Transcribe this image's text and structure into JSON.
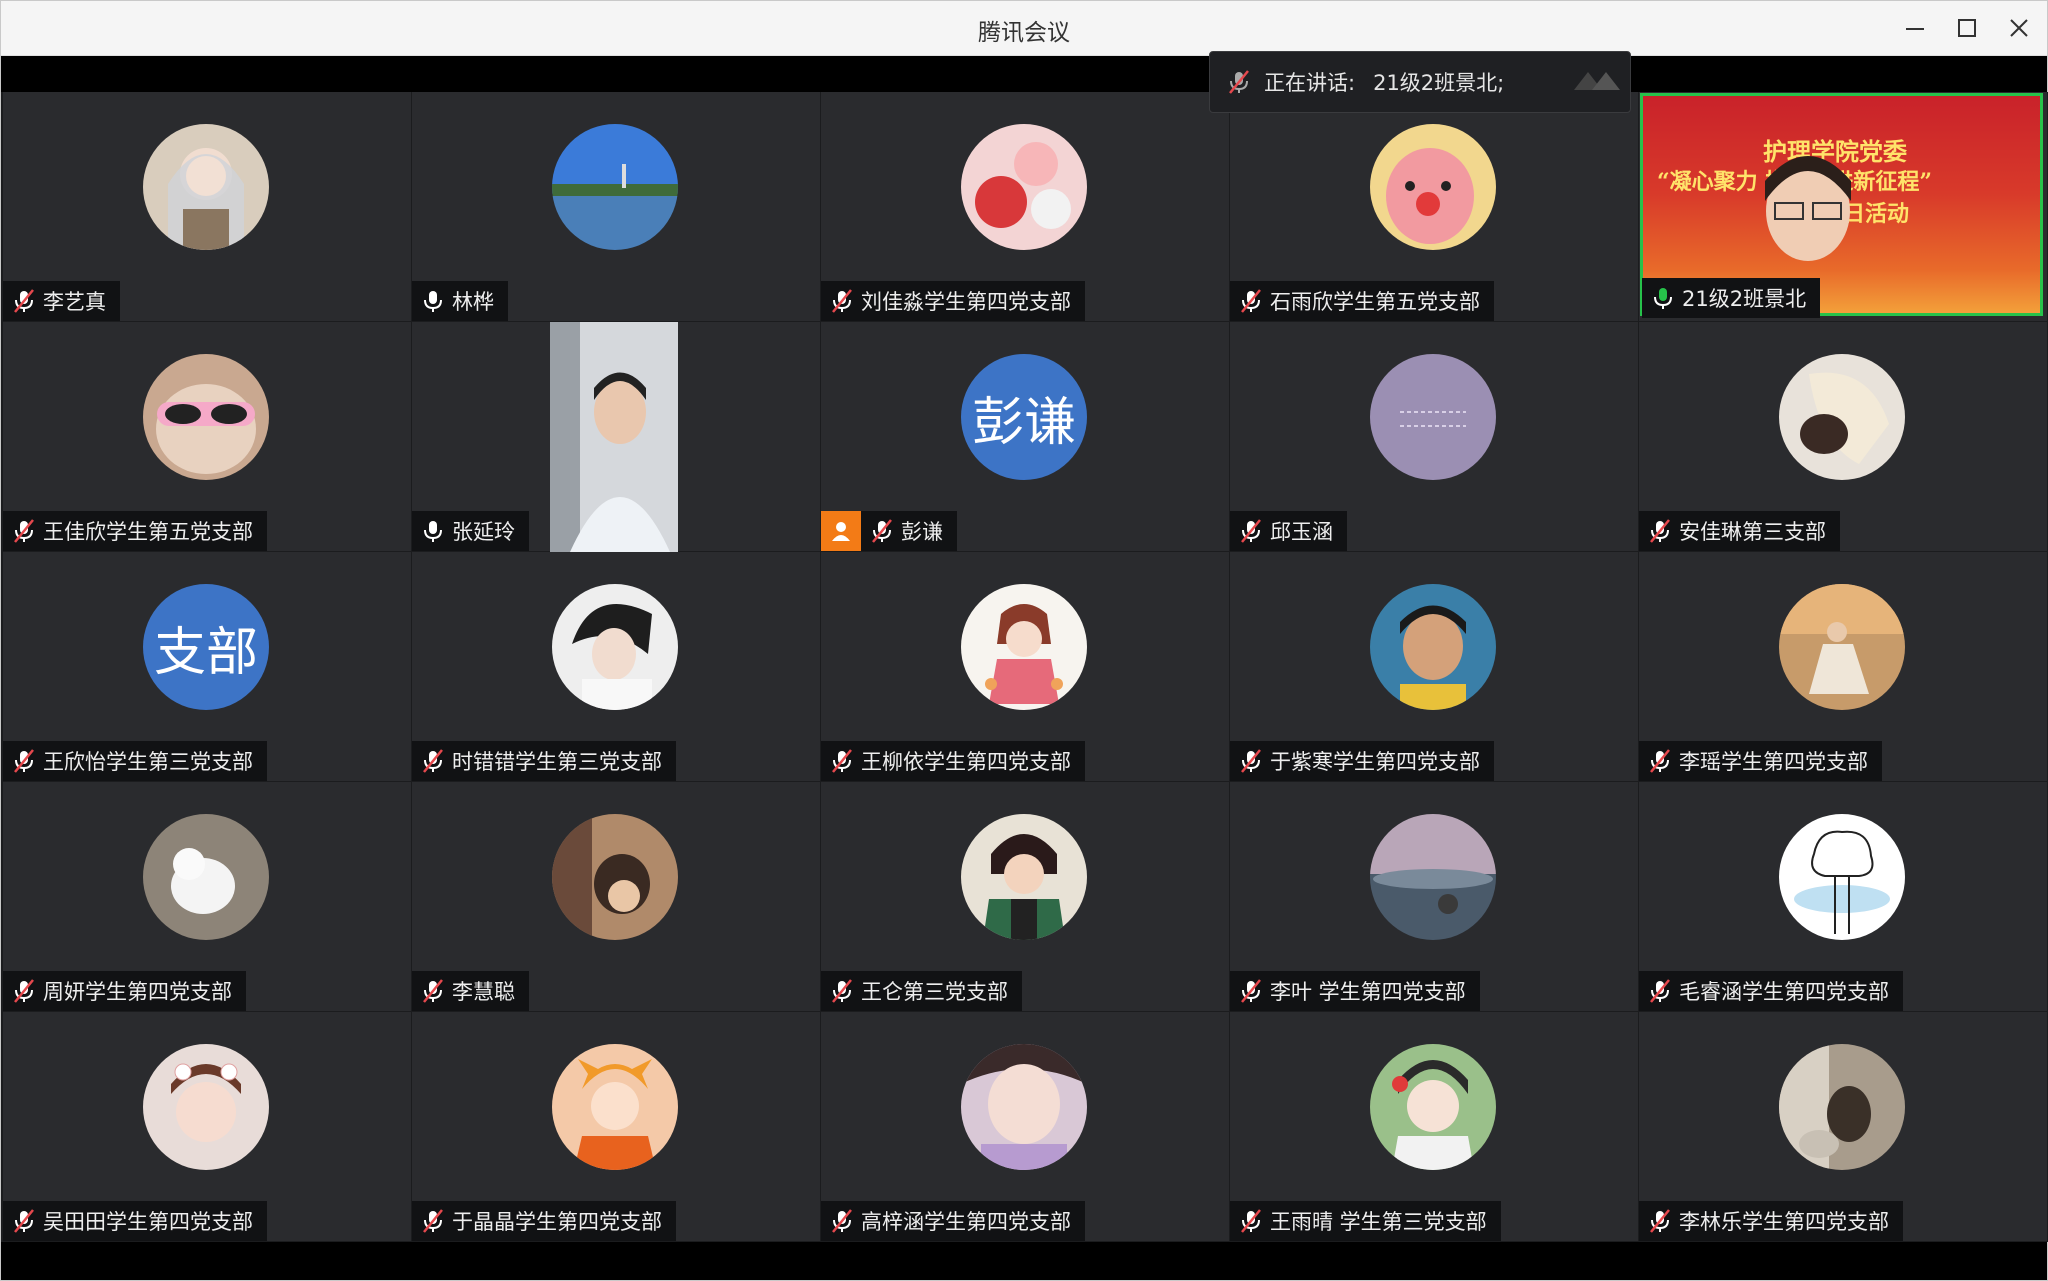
{
  "window": {
    "title": "腾讯会议"
  },
  "speaking": {
    "label": "正在讲话:",
    "speaker": "21级2班景北;"
  },
  "active_speaker_banner": {
    "line1": "护理学院党委",
    "line2": "“凝心聚力  携手奋进新征程”",
    "line3": "日活动"
  },
  "avatar_text": {
    "r1c2": "彭谦",
    "r2c0": "支部"
  },
  "participants": [
    {
      "name": "李艺真",
      "mic": "muted"
    },
    {
      "name": "林桦",
      "mic": "on"
    },
    {
      "name": "刘佳淼学生第四党支部",
      "mic": "muted"
    },
    {
      "name": "石雨欣学生第五党支部",
      "mic": "muted"
    },
    {
      "name": "21级2班景北",
      "mic": "speaking"
    },
    {
      "name": "王佳欣学生第五党支部",
      "mic": "muted"
    },
    {
      "name": "张延玲",
      "mic": "on"
    },
    {
      "name": "彭谦",
      "mic": "muted",
      "host": true
    },
    {
      "name": "邱玉涵",
      "mic": "muted"
    },
    {
      "name": "安佳琳第三支部",
      "mic": "muted"
    },
    {
      "name": "王欣怡学生第三党支部",
      "mic": "muted"
    },
    {
      "name": "时错错学生第三党支部",
      "mic": "muted"
    },
    {
      "name": "王柳依学生第四党支部",
      "mic": "muted"
    },
    {
      "name": "于紫寒学生第四党支部",
      "mic": "muted"
    },
    {
      "name": "李瑶学生第四党支部",
      "mic": "muted"
    },
    {
      "name": "周妍学生第四党支部",
      "mic": "muted"
    },
    {
      "name": "李慧聪",
      "mic": "muted"
    },
    {
      "name": "王仑第三党支部",
      "mic": "muted"
    },
    {
      "name": "李叶 学生第四党支部",
      "mic": "muted"
    },
    {
      "name": "毛睿涵学生第四党支部",
      "mic": "muted"
    },
    {
      "name": "吴田田学生第四党支部",
      "mic": "muted"
    },
    {
      "name": "于晶晶学生第四党支部",
      "mic": "muted"
    },
    {
      "name": "高梓涵学生第四党支部",
      "mic": "muted"
    },
    {
      "name": "王雨晴 学生第三党支部",
      "mic": "muted"
    },
    {
      "name": "李林乐学生第四党支部",
      "mic": "muted"
    }
  ],
  "colors": {
    "background": "#1b1c1e",
    "tile": "#2a2b2e",
    "active_border": "#26c24a",
    "muted_red": "#e5484d",
    "host_orange": "#f37b16"
  }
}
